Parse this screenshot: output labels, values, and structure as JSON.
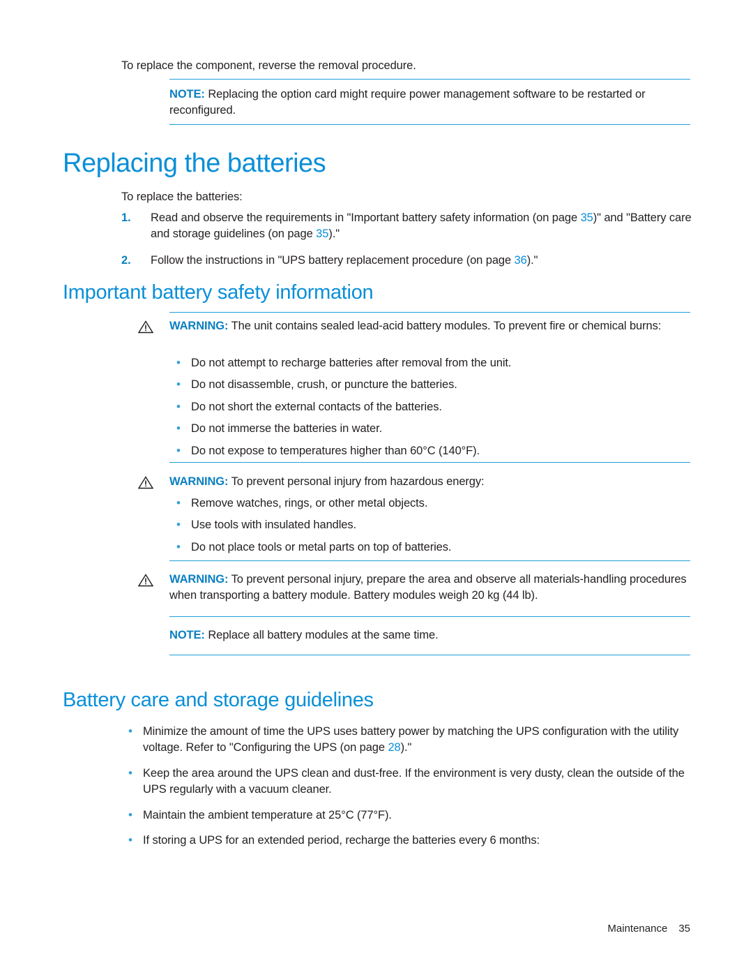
{
  "document": {
    "intro_line": "To replace the component, reverse the removal procedure.",
    "note_top": {
      "label": "NOTE:",
      "text": "Replacing the option card might require power management software to be restarted or reconfigured."
    },
    "heading_replacing_batteries": "Replacing the batteries",
    "lead_in": "To replace the batteries:",
    "steps": [
      {
        "number": "1.",
        "text_before": "Read and observe the requirements in \"Important battery safety information (on page ",
        "ref1": "35",
        "text_middle": ")\" and \"Battery care and storage guidelines (on page ",
        "ref2": "35",
        "text_after": ").\""
      },
      {
        "number": "2.",
        "text_before": "Follow the instructions in \"UPS battery replacement procedure (on page ",
        "ref1": "36",
        "text_after": ").\""
      }
    ],
    "heading_safety": "Important battery safety information",
    "warning_1": {
      "label": "WARNING:",
      "text": "The unit contains sealed lead-acid battery modules. To prevent fire or chemical burns:",
      "items": [
        "Do not attempt to recharge batteries after removal from the unit.",
        "Do not disassemble, crush, or puncture the batteries.",
        "Do not short the external contacts of the batteries.",
        "Do not immerse the batteries in water.",
        "Do not expose to temperatures higher than 60°C (140°F)."
      ]
    },
    "warning_2": {
      "label": "WARNING:",
      "text": "To prevent personal injury from hazardous energy:",
      "items": [
        "Remove watches, rings, or other metal objects.",
        "Use tools with insulated handles.",
        "Do not place tools or metal parts on top of batteries."
      ]
    },
    "warning_3": {
      "label": "WARNING:",
      "text": "To prevent personal injury, prepare the area and observe all materials-handling procedures when transporting a battery module. Battery modules weigh 20 kg (44 lb)."
    },
    "note_bottom": {
      "label": "NOTE:",
      "text": "Replace all battery modules at the same time."
    },
    "heading_care": "Battery care and storage guidelines",
    "care_bullets": [
      {
        "text_before": "Minimize the amount of time the UPS uses battery power by matching the UPS configuration with the utility voltage. Refer to \"Configuring the UPS (on page ",
        "ref1": "28",
        "text_after": ").\""
      },
      {
        "text_before": "Keep the area around the UPS clean and dust-free. If the environment is very dusty, clean the outside of the UPS regularly with a vacuum cleaner."
      },
      {
        "text_before": "Maintain the ambient temperature at 25°C (77°F)."
      },
      {
        "text_before": "If storing a UPS for an extended period, recharge the batteries every 6 months:"
      }
    ],
    "footer": {
      "section": "Maintenance",
      "page": "35"
    },
    "colors": {
      "heading_blue": "#0a8fd8",
      "label_blue": "#0a7fc1",
      "rule_blue": "#1f9fd8",
      "bullet_blue": "#2f9fd8",
      "body": "#231f20"
    }
  }
}
